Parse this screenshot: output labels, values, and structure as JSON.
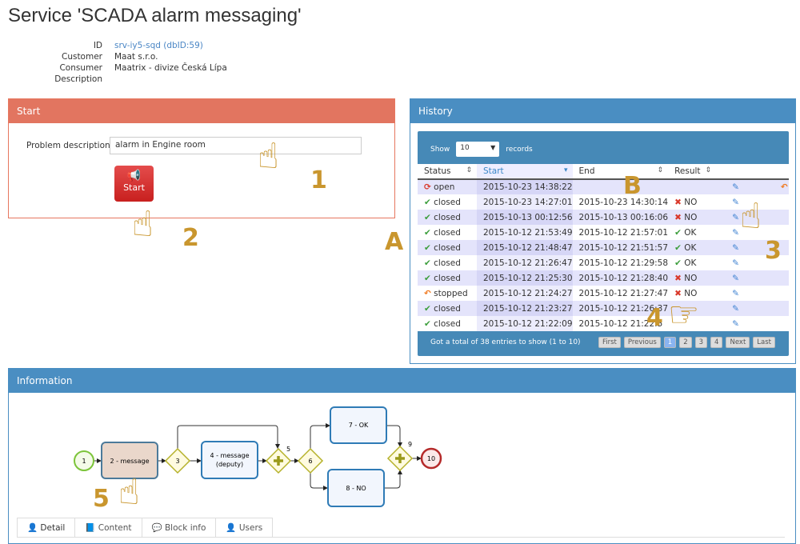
{
  "title": "Service 'SCADA alarm messaging'",
  "meta": [
    {
      "key": "ID",
      "value": "srv-iy5-sqd (dbID:59)"
    },
    {
      "key": "Customer",
      "value": "Maat s.r.o."
    },
    {
      "key": "Consumer",
      "value": "Maatrix - divize Česká Lípa"
    },
    {
      "key": "Description",
      "value": ""
    }
  ],
  "start": {
    "title": "Start",
    "label": "Problem description",
    "value": "alarm in Engine room",
    "button": "Start",
    "icon": "bullhorn-icon"
  },
  "history": {
    "title": "History",
    "show": "Show",
    "records": "records",
    "page_size": "10",
    "columns": [
      "Status",
      "Start",
      "End",
      "Result"
    ],
    "rows": [
      {
        "status": "open",
        "icon": "refresh",
        "start": "2015-10-23 14:38:22",
        "end": "",
        "result": "",
        "undo": true
      },
      {
        "status": "closed",
        "icon": "check",
        "start": "2015-10-23 14:27:01",
        "end": "2015-10-23 14:30:14",
        "result": "NO"
      },
      {
        "status": "closed",
        "icon": "check",
        "start": "2015-10-13 00:12:56",
        "end": "2015-10-13 00:16:06",
        "result": "NO"
      },
      {
        "status": "closed",
        "icon": "check",
        "start": "2015-10-12 21:53:49",
        "end": "2015-10-12 21:57:01",
        "result": "OK"
      },
      {
        "status": "closed",
        "icon": "check",
        "start": "2015-10-12 21:48:47",
        "end": "2015-10-12 21:51:57",
        "result": "OK"
      },
      {
        "status": "closed",
        "icon": "check",
        "start": "2015-10-12 21:26:47",
        "end": "2015-10-12 21:29:58",
        "result": "OK"
      },
      {
        "status": "closed",
        "icon": "check",
        "start": "2015-10-12 21:25:30",
        "end": "2015-10-12 21:28:40",
        "result": "NO"
      },
      {
        "status": "stopped",
        "icon": "undo",
        "start": "2015-10-12 21:24:27",
        "end": "2015-10-12 21:27:47",
        "result": "NO"
      },
      {
        "status": "closed",
        "icon": "check",
        "start": "2015-10-12 21:23:27",
        "end": "2015-10-12 21:26:37",
        "result": ""
      },
      {
        "status": "closed",
        "icon": "check",
        "start": "2015-10-12 21:22:09",
        "end": "2015-10-12 21:22:5",
        "result": ""
      }
    ],
    "total": "Got a total of 38 entries to show (1 to 10)",
    "pager": [
      "First",
      "Previous",
      "1",
      "2",
      "3",
      "4",
      "Next",
      "Last"
    ],
    "current_page": "1"
  },
  "info": {
    "title": "Information",
    "diagram": {
      "n1": "1",
      "n2": "2 - message",
      "n3": "3",
      "n4a": "4 - message",
      "n4b": "(deputy)",
      "n5": "5",
      "n6": "6",
      "n7": "7 - OK",
      "n8": "8 - NO",
      "n9": "9",
      "n10": "10"
    },
    "tabs": [
      "Detail",
      "Content",
      "Block info",
      "Users"
    ]
  },
  "annotations": [
    "1",
    "2",
    "3",
    "4",
    "5",
    "A",
    "B"
  ],
  "colors": {
    "start_header": "#e27560",
    "panel_blue": "#4a8ec2",
    "ok": "#3c9e3c",
    "no": "#d9392b",
    "annotation": "#c9962e"
  }
}
